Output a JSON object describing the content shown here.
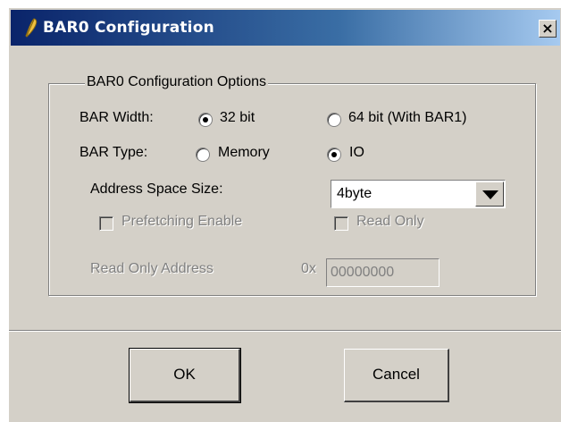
{
  "window": {
    "title": "BAR0 Configuration",
    "close_glyph": "×",
    "title_icon": "feather-icon"
  },
  "group": {
    "legend": "BAR0 Configuration Options"
  },
  "bar_width": {
    "label": "BAR Width:",
    "options": [
      {
        "label": "32 bit",
        "selected": true
      },
      {
        "label": "64 bit (With BAR1)",
        "selected": false
      }
    ]
  },
  "bar_type": {
    "label": "BAR Type:",
    "options": [
      {
        "label": "Memory",
        "selected": false
      },
      {
        "label": "IO",
        "selected": true
      }
    ]
  },
  "address_space": {
    "label": "Address Space Size:",
    "value": "4byte"
  },
  "prefetching": {
    "label": "Prefetching Enable",
    "checked": false,
    "enabled": false
  },
  "read_only": {
    "label": "Read Only",
    "checked": false,
    "enabled": false
  },
  "read_only_address": {
    "label": "Read Only Address",
    "prefix": "0x",
    "value": "00000000",
    "enabled": false
  },
  "buttons": {
    "ok": "OK",
    "cancel": "Cancel"
  }
}
